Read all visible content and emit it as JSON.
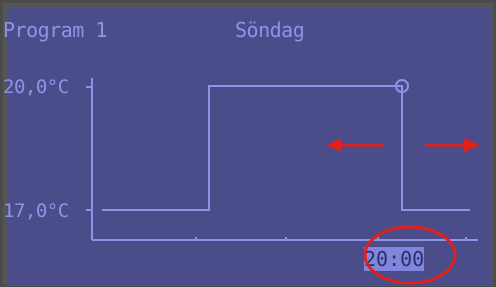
{
  "header": {
    "program": "Program 1",
    "day": "Söndag"
  },
  "temperatures": {
    "high": "20,0°C",
    "low": "17,0°C"
  },
  "selected_time": "20:00",
  "colors": {
    "screen_bg": "#4b4d8a",
    "line": "#8c94e6",
    "highlight": "#7f86dc",
    "annotation_red": "#e0201a"
  },
  "icons": {
    "left_arrow": "arrow-left-icon",
    "right_arrow": "arrow-right-icon",
    "handle": "circle-handle-icon"
  }
}
